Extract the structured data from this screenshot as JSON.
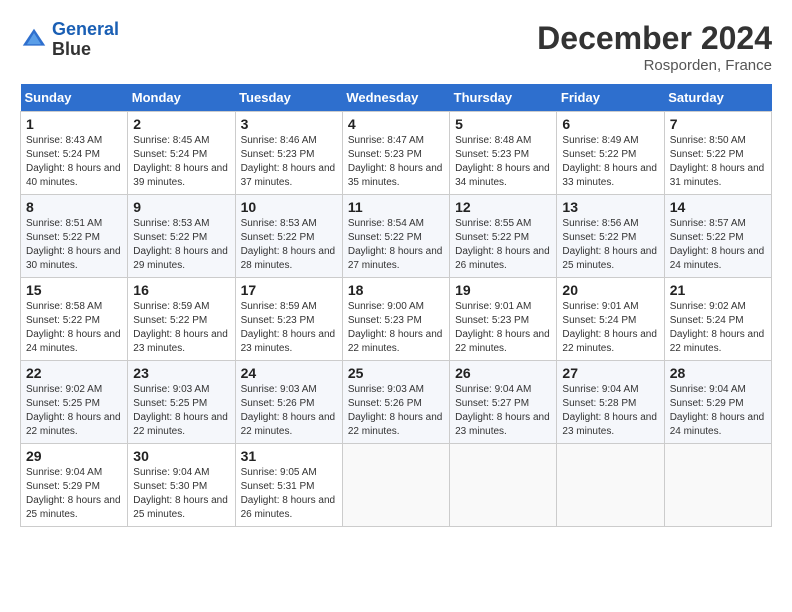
{
  "header": {
    "logo_line1": "General",
    "logo_line2": "Blue",
    "month": "December 2024",
    "location": "Rosporden, France"
  },
  "weekdays": [
    "Sunday",
    "Monday",
    "Tuesday",
    "Wednesday",
    "Thursday",
    "Friday",
    "Saturday"
  ],
  "weeks": [
    [
      {
        "day": "1",
        "sunrise": "8:43 AM",
        "sunset": "5:24 PM",
        "daylight": "8 hours and 40 minutes."
      },
      {
        "day": "2",
        "sunrise": "8:45 AM",
        "sunset": "5:24 PM",
        "daylight": "8 hours and 39 minutes."
      },
      {
        "day": "3",
        "sunrise": "8:46 AM",
        "sunset": "5:23 PM",
        "daylight": "8 hours and 37 minutes."
      },
      {
        "day": "4",
        "sunrise": "8:47 AM",
        "sunset": "5:23 PM",
        "daylight": "8 hours and 35 minutes."
      },
      {
        "day": "5",
        "sunrise": "8:48 AM",
        "sunset": "5:23 PM",
        "daylight": "8 hours and 34 minutes."
      },
      {
        "day": "6",
        "sunrise": "8:49 AM",
        "sunset": "5:22 PM",
        "daylight": "8 hours and 33 minutes."
      },
      {
        "day": "7",
        "sunrise": "8:50 AM",
        "sunset": "5:22 PM",
        "daylight": "8 hours and 31 minutes."
      }
    ],
    [
      {
        "day": "8",
        "sunrise": "8:51 AM",
        "sunset": "5:22 PM",
        "daylight": "8 hours and 30 minutes."
      },
      {
        "day": "9",
        "sunrise": "8:53 AM",
        "sunset": "5:22 PM",
        "daylight": "8 hours and 29 minutes."
      },
      {
        "day": "10",
        "sunrise": "8:53 AM",
        "sunset": "5:22 PM",
        "daylight": "8 hours and 28 minutes."
      },
      {
        "day": "11",
        "sunrise": "8:54 AM",
        "sunset": "5:22 PM",
        "daylight": "8 hours and 27 minutes."
      },
      {
        "day": "12",
        "sunrise": "8:55 AM",
        "sunset": "5:22 PM",
        "daylight": "8 hours and 26 minutes."
      },
      {
        "day": "13",
        "sunrise": "8:56 AM",
        "sunset": "5:22 PM",
        "daylight": "8 hours and 25 minutes."
      },
      {
        "day": "14",
        "sunrise": "8:57 AM",
        "sunset": "5:22 PM",
        "daylight": "8 hours and 24 minutes."
      }
    ],
    [
      {
        "day": "15",
        "sunrise": "8:58 AM",
        "sunset": "5:22 PM",
        "daylight": "8 hours and 24 minutes."
      },
      {
        "day": "16",
        "sunrise": "8:59 AM",
        "sunset": "5:22 PM",
        "daylight": "8 hours and 23 minutes."
      },
      {
        "day": "17",
        "sunrise": "8:59 AM",
        "sunset": "5:23 PM",
        "daylight": "8 hours and 23 minutes."
      },
      {
        "day": "18",
        "sunrise": "9:00 AM",
        "sunset": "5:23 PM",
        "daylight": "8 hours and 22 minutes."
      },
      {
        "day": "19",
        "sunrise": "9:01 AM",
        "sunset": "5:23 PM",
        "daylight": "8 hours and 22 minutes."
      },
      {
        "day": "20",
        "sunrise": "9:01 AM",
        "sunset": "5:24 PM",
        "daylight": "8 hours and 22 minutes."
      },
      {
        "day": "21",
        "sunrise": "9:02 AM",
        "sunset": "5:24 PM",
        "daylight": "8 hours and 22 minutes."
      }
    ],
    [
      {
        "day": "22",
        "sunrise": "9:02 AM",
        "sunset": "5:25 PM",
        "daylight": "8 hours and 22 minutes."
      },
      {
        "day": "23",
        "sunrise": "9:03 AM",
        "sunset": "5:25 PM",
        "daylight": "8 hours and 22 minutes."
      },
      {
        "day": "24",
        "sunrise": "9:03 AM",
        "sunset": "5:26 PM",
        "daylight": "8 hours and 22 minutes."
      },
      {
        "day": "25",
        "sunrise": "9:03 AM",
        "sunset": "5:26 PM",
        "daylight": "8 hours and 22 minutes."
      },
      {
        "day": "26",
        "sunrise": "9:04 AM",
        "sunset": "5:27 PM",
        "daylight": "8 hours and 23 minutes."
      },
      {
        "day": "27",
        "sunrise": "9:04 AM",
        "sunset": "5:28 PM",
        "daylight": "8 hours and 23 minutes."
      },
      {
        "day": "28",
        "sunrise": "9:04 AM",
        "sunset": "5:29 PM",
        "daylight": "8 hours and 24 minutes."
      }
    ],
    [
      {
        "day": "29",
        "sunrise": "9:04 AM",
        "sunset": "5:29 PM",
        "daylight": "8 hours and 25 minutes."
      },
      {
        "day": "30",
        "sunrise": "9:04 AM",
        "sunset": "5:30 PM",
        "daylight": "8 hours and 25 minutes."
      },
      {
        "day": "31",
        "sunrise": "9:05 AM",
        "sunset": "5:31 PM",
        "daylight": "8 hours and 26 minutes."
      },
      null,
      null,
      null,
      null
    ]
  ]
}
